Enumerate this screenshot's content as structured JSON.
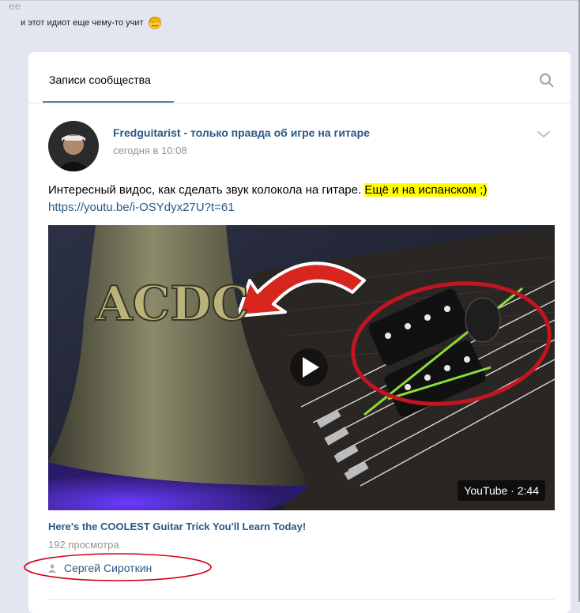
{
  "comment": {
    "quote_mark": "ee",
    "text": "и этот идиот еще чему-то учит",
    "emoji_icon": "facepalm-emoji-icon"
  },
  "widget": {
    "tab_label": "Записи сообщества",
    "search_icon": "search-icon"
  },
  "post": {
    "author": "Fredguitarist - только правда об игре на гитаре",
    "time": "сегодня в 10:08",
    "text_main": "Интересный видос, как сделать звук колокола на гитаре. ",
    "text_highlight": "Ещё и на испанском ;)",
    "link": "https://youtu.be/i-OSYdyx27U?t=61",
    "highlight_color": "#ffff00",
    "video": {
      "bell_text": "ACDC",
      "badge": "YouTube · 2:44",
      "title": "Here's the COOLEST Guitar Trick You'll Learn Today!",
      "views": "192 просмотра"
    },
    "signer": "Сергей Сироткин"
  },
  "colors": {
    "link": "#2a5885",
    "accent": "#5181b8",
    "muted": "#939393",
    "annotation_red": "#d0021b"
  }
}
